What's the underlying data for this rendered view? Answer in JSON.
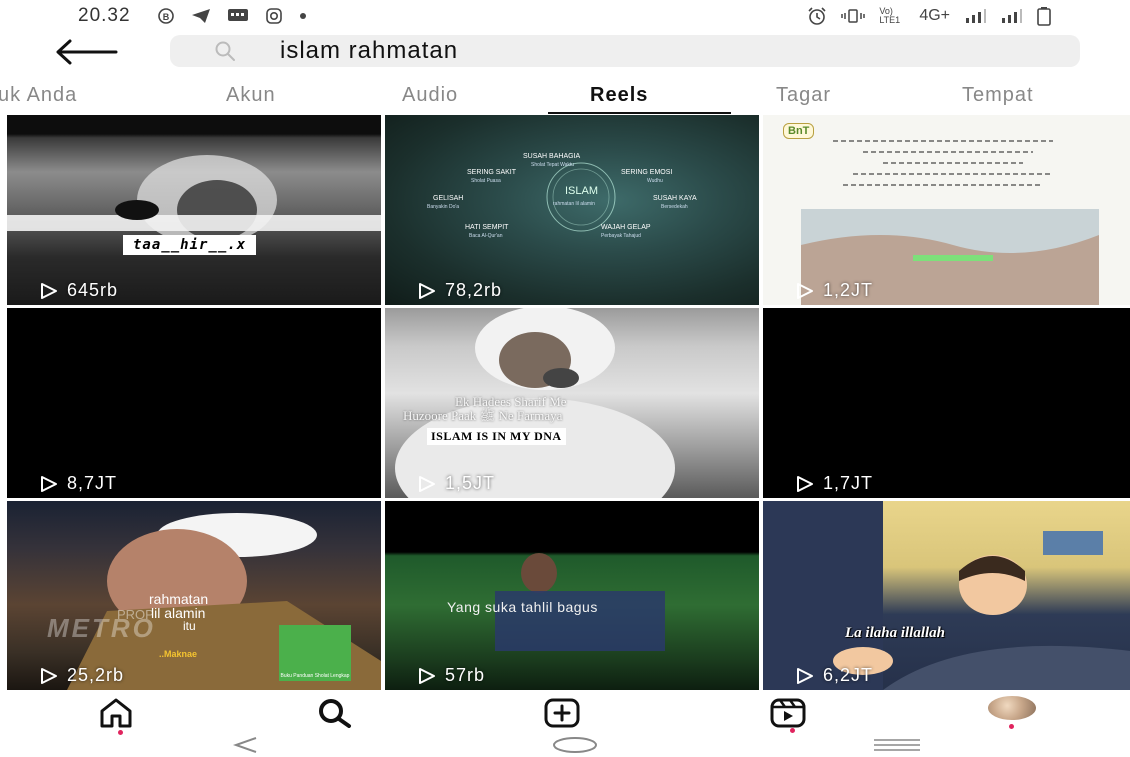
{
  "status_bar": {
    "time": "20.32",
    "left_icons": [
      "b-circle-icon",
      "telegram-icon",
      "message-icon",
      "instagram-icon",
      "dot-icon"
    ],
    "network_label": "4G+",
    "volte_label": "Vo) LTE1"
  },
  "search": {
    "query": "islam rahmatan"
  },
  "tabs": [
    {
      "label": "Untuk Anda",
      "display": "uk Anda",
      "active": false
    },
    {
      "label": "Akun",
      "active": false
    },
    {
      "label": "Audio",
      "active": false
    },
    {
      "label": "Reels",
      "active": true
    },
    {
      "label": "Tagar",
      "active": false
    },
    {
      "label": "Tempat",
      "active": false
    }
  ],
  "reels": [
    {
      "views": "645rb",
      "caption": "taa__hir__.x"
    },
    {
      "views": "78,2rb",
      "title": "ISLAM",
      "subtitle": "rahmatan lil alamin",
      "labels": [
        "SUSAH BAHAGIA",
        "Sholat Tepat Waktu",
        "SERING SAKIT",
        "Sholat Puasa",
        "SERING EMOSI",
        "Wudhu",
        "GELISAH",
        "Banyakin Do'a",
        "SUSAH KAYA",
        "Bersedekah",
        "HATI SEMPIT",
        "Baca Al-Qur'an",
        "WAJAH GELAP",
        "Perbayak Tahajud"
      ]
    },
    {
      "views": "1,2JT",
      "logo": "BnT"
    },
    {
      "views": "8,7JT"
    },
    {
      "views": "1,5JT",
      "line1": "Ek Hadees Sharif Me",
      "line2": "Huzoore Paak ﷺ Ne Farmaya",
      "banner": "ISLAM IS IN MY DNA"
    },
    {
      "views": "1,7JT"
    },
    {
      "views": "25,2rb",
      "line1": "rahmatan",
      "line2": "lil alamin",
      "line3": "itu",
      "watermark": "METRO",
      "prop": "PROP",
      "book": "Buku Panduan Sholat Lengkap",
      "brand": "..Maknae"
    },
    {
      "views": "57rb",
      "caption": "Yang suka tahlil bagus"
    },
    {
      "views": "6,2JT",
      "caption": "La ilaha illallah"
    }
  ],
  "bottom_nav": [
    "home-icon",
    "search-icon",
    "create-icon",
    "reels-icon",
    "profile-avatar"
  ],
  "colors": {
    "accent": "#e0245e",
    "tab_active": "#111111",
    "tab_inactive": "#888888",
    "search_bg": "#efefef"
  }
}
